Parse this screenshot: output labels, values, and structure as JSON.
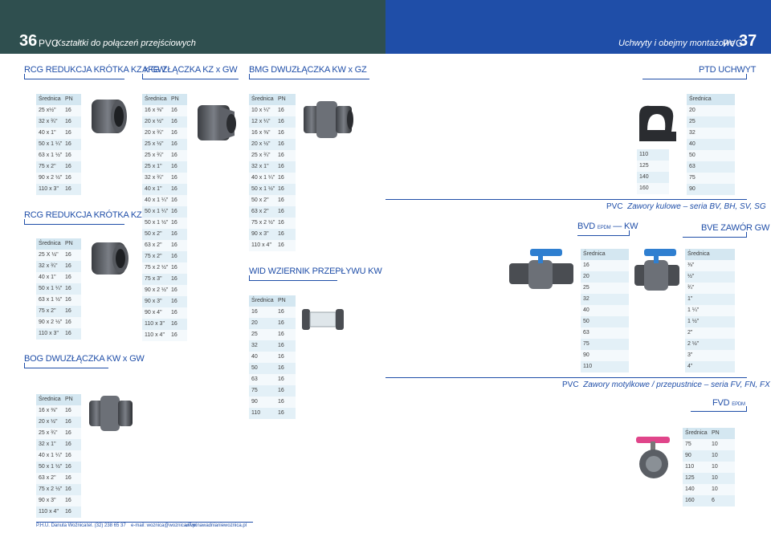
{
  "header": {
    "left_page_number": "36",
    "left_pvc": "PVC",
    "left_subtitle": "Kształtki do połączeń przejściowych",
    "right_subtitle": "Uchwyty i obejmy montażowe",
    "right_pvc": "PVC",
    "right_page_number": "37"
  },
  "sections": {
    "rcg1": "RCG REDUKCJA KRÓTKA KZ x GW",
    "afg": "AFG ZŁĄCZKA KZ x GW",
    "bmg": "BMG DWUZŁĄCZKA KW x GZ",
    "ptd": "PTD UCHWYT",
    "rcg2": "RCG REDUKCJA KRÓTKA KZ x GW",
    "wid": "WID WZIERNIK PRZEPŁYWU KW",
    "bog": "BOG DWUZŁĄCZKA KW x GW",
    "bvd": "BVD",
    "bvd_sub": "EPDM",
    "bvd_kw": "— KW",
    "bve": "BVE ZAWÓR GW",
    "fvd": "FVD",
    "fvd_sub": "EPDM"
  },
  "banners": {
    "ball_pvc": "PVC",
    "ball_text": "Zawory kulowe – seria BV, BH, SV, SG",
    "butterfly_pvc": "PVC",
    "butterfly_text": "Zawory motylkowe / przepustnice – seria FV, FN, FX"
  },
  "tables": {
    "rcg1": {
      "h1": "Średnica",
      "h2": "PN",
      "rows": [
        [
          "25 x½\"",
          "16"
        ],
        [
          "32 x ¾\"",
          "16"
        ],
        [
          "40 x 1\"",
          "16"
        ],
        [
          "50 x 1 ¼\"",
          "16"
        ],
        [
          "63 x 1 ½\"",
          "16"
        ],
        [
          "75 x 2\"",
          "16"
        ],
        [
          "90 x 2 ½\"",
          "16"
        ],
        [
          "110 x 3\"",
          "16"
        ]
      ]
    },
    "afg": {
      "h1": "Średnica",
      "h2": "PN",
      "rows": [
        [
          "16 x ⅜\"",
          "16"
        ],
        [
          "20 x ½\"",
          "16"
        ],
        [
          "20 x ¾\"",
          "16"
        ],
        [
          "25 x ½\"",
          "16"
        ],
        [
          "25 x ¾\"",
          "16"
        ],
        [
          "25 x 1\"",
          "16"
        ],
        [
          "32 x ¾\"",
          "16"
        ],
        [
          "40 x 1\"",
          "16"
        ],
        [
          "40 x 1 ¼\"",
          "16"
        ],
        [
          "50 x 1 ¼\"",
          "16"
        ],
        [
          "50 x 1 ½\"",
          "16"
        ],
        [
          "50 x 2\"",
          "16"
        ],
        [
          "63 x 2\"",
          "16"
        ],
        [
          "75 x 2\"",
          "16"
        ],
        [
          "75 x 2 ½\"",
          "16"
        ],
        [
          "75 x 3\"",
          "16"
        ],
        [
          "90 x 2 ½\"",
          "16"
        ],
        [
          "90 x 3\"",
          "16"
        ],
        [
          "90 x 4\"",
          "16"
        ],
        [
          "110 x 3\"",
          "16"
        ],
        [
          "110 x 4\"",
          "16"
        ]
      ]
    },
    "bmg": {
      "h1": "Średnica",
      "h2": "PN",
      "rows": [
        [
          "10 x ¼\"",
          "16"
        ],
        [
          "12 x ¼\"",
          "16"
        ],
        [
          "16 x ⅜\"",
          "16"
        ],
        [
          "20 x ½\"",
          "16"
        ],
        [
          "25 x ¾\"",
          "16"
        ],
        [
          "32 x 1\"",
          "16"
        ],
        [
          "40 x 1 ¼\"",
          "16"
        ],
        [
          "50 x 1 ½\"",
          "16"
        ],
        [
          "50 x 2\"",
          "16"
        ],
        [
          "63 x 2\"",
          "16"
        ],
        [
          "75 x 2 ½\"",
          "16"
        ],
        [
          "90 x 3\"",
          "16"
        ],
        [
          "110 x 4\"",
          "16"
        ]
      ]
    },
    "ptd_small": {
      "rows": [
        "110",
        "125",
        "140",
        "160"
      ]
    },
    "ptd": {
      "h1": "Średnica",
      "rows": [
        "20",
        "25",
        "32",
        "40",
        "50",
        "63",
        "75",
        "90"
      ]
    },
    "rcg2": {
      "h1": "Średnica",
      "h2": "PN",
      "rows": [
        [
          "25 X ½\"",
          "16"
        ],
        [
          "32 x ¾\"",
          "16"
        ],
        [
          "40 x 1\"",
          "16"
        ],
        [
          "50 x 1 ¼\"",
          "16"
        ],
        [
          "63 x 1 ½\"",
          "16"
        ],
        [
          "75 x 2\"",
          "16"
        ],
        [
          "90 x 2 ½\"",
          "16"
        ],
        [
          "110 x 3\"",
          "16"
        ]
      ]
    },
    "wid": {
      "h1": "Średnica",
      "h2": "PN",
      "rows": [
        [
          "16",
          "16"
        ],
        [
          "20",
          "16"
        ],
        [
          "25",
          "16"
        ],
        [
          "32",
          "16"
        ],
        [
          "40",
          "16"
        ],
        [
          "50",
          "16"
        ],
        [
          "63",
          "16"
        ],
        [
          "75",
          "16"
        ],
        [
          "90",
          "16"
        ],
        [
          "110",
          "16"
        ]
      ]
    },
    "bog": {
      "h1": "Średnica",
      "h2": "PN",
      "rows": [
        [
          "16 x ⅜\"",
          "16"
        ],
        [
          "20 x ½\"",
          "16"
        ],
        [
          "25 x ¾\"",
          "16"
        ],
        [
          "32 x 1\"",
          "16"
        ],
        [
          "40 x 1 ¼\"",
          "16"
        ],
        [
          "50 x 1 ½\"",
          "16"
        ],
        [
          "63 x 2\"",
          "16"
        ],
        [
          "75 x 2 ½\"",
          "16"
        ],
        [
          "90 x 3\"",
          "16"
        ],
        [
          "110 x 4\"",
          "16"
        ]
      ]
    },
    "bvd": {
      "h1": "Średnica",
      "rows": [
        "16",
        "20",
        "25",
        "32",
        "40",
        "50",
        "63",
        "75",
        "90",
        "110"
      ]
    },
    "bve": {
      "h1": "Średnica",
      "rows": [
        "⅜\"",
        "½\"",
        "¾\"",
        "1\"",
        "1 ¼\"",
        "1 ½\"",
        "2\"",
        "2 ½\"",
        "3\"",
        "4\""
      ]
    },
    "fvd": {
      "h1": "Średnica",
      "h2": "PN",
      "rows": [
        [
          "75",
          "10"
        ],
        [
          "90",
          "10"
        ],
        [
          "110",
          "10"
        ],
        [
          "125",
          "10"
        ],
        [
          "140",
          "10"
        ],
        [
          "160",
          "6"
        ]
      ]
    }
  },
  "footer": {
    "company": "P.H.U. Danuta Woźnica",
    "phone": "tel. (32) 238 65 37",
    "email": "e-mail: woznica@woznica.i7.pl",
    "web": "www.nawadnianiewoznica.pl"
  },
  "colors": {
    "left_header": "#2f4f4f",
    "right_header": "#1f4ea8",
    "accent": "#1f4ea8",
    "table_row": "#e3f0f7"
  },
  "icons": [
    "pvc-reducer-photo",
    "pvc-adapter-photo",
    "pvc-union-photo",
    "pipe-clip-photo",
    "sight-glass-photo",
    "ball-valve-photo",
    "butterfly-valve-photo"
  ]
}
